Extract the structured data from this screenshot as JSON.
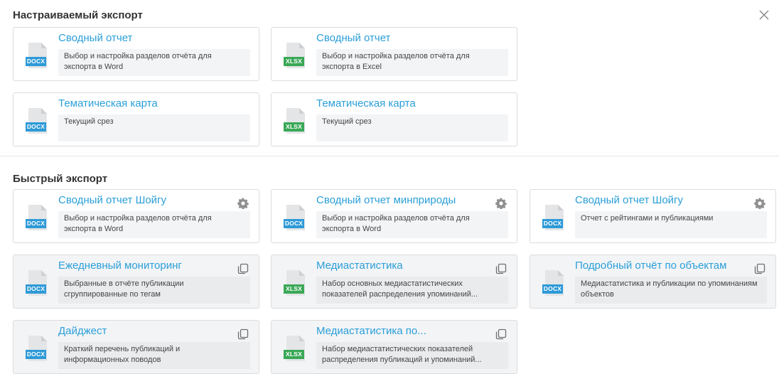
{
  "custom_export": {
    "title": "Настраиваемый экспорт",
    "cards": [
      {
        "title": "Сводный отчет",
        "desc": "Выбор и настройка разделов отчёта для экспорта в Word",
        "format": "DOCX"
      },
      {
        "title": "Сводный отчет",
        "desc": "Выбор и настройка разделов отчёта для экспорта в Excel",
        "format": "XLSX"
      },
      {
        "title": "Тематическая карта",
        "desc": "Текущий срез",
        "format": "DOCX"
      },
      {
        "title": "Тематическая карта",
        "desc": "Текущий срез",
        "format": "XLSX"
      }
    ]
  },
  "quick_export": {
    "title": "Быстрый экспорт",
    "cards": [
      {
        "title": "Сводный отчет Шойгу",
        "desc": "Выбор и настройка разделов отчёта для экспорта в Word",
        "format": "DOCX",
        "action_icon": "gear-icon"
      },
      {
        "title": "Сводный отчет минприроды",
        "desc": "Выбор и настройка разделов отчёта для экспорта в Word",
        "format": "DOCX",
        "action_icon": "gear-icon"
      },
      {
        "title": "Сводный отчет Шойгу",
        "desc": "Отчет с рейтингами и публикациями",
        "format": "DOCX",
        "action_icon": "gear-icon"
      },
      {
        "title": "Ежедневный мониторинг",
        "desc": "Выбранные в отчёте публикации сгруппированные по тегам",
        "format": "DOCX",
        "action_icon": "copy-icon"
      },
      {
        "title": "Медиастатистика",
        "desc": "Набор основных медиастатистических показателей распределения упоминаний...",
        "format": "XLSX",
        "action_icon": "copy-icon"
      },
      {
        "title": "Подробный отчёт по объектам",
        "desc": "Медиастатистика и публикации по упоминаниям объектов",
        "format": "DOCX",
        "action_icon": "copy-icon"
      },
      {
        "title": "Дайджест",
        "desc": "Краткий перечень публикаций и информационных поводов",
        "format": "DOCX",
        "action_icon": "copy-icon"
      },
      {
        "title": "Медиастатистика по...",
        "desc": "Набор медиастатистических показателей распределения публикаций и упоминаний...",
        "format": "XLSX",
        "action_icon": "copy-icon"
      }
    ]
  },
  "colors": {
    "accent": "#2a9fd8",
    "docx": "#2e9ad7",
    "xlsx": "#3aa856"
  },
  "close_icon": "close-icon"
}
